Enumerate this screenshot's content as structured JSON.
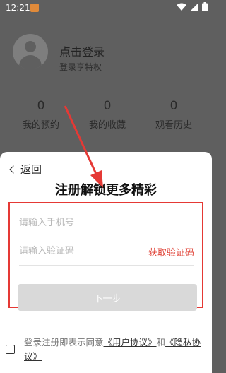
{
  "status_bar": {
    "time": "12:21"
  },
  "profile": {
    "login_title": "点击登录",
    "login_subtitle": "登录享特权",
    "stats": [
      {
        "value": "0",
        "label": "我的预约"
      },
      {
        "value": "0",
        "label": "我的收藏"
      },
      {
        "value": "0",
        "label": "观看历史"
      }
    ]
  },
  "sheet": {
    "back_label": "返回",
    "title": "注册解锁更多精彩",
    "phone_placeholder": "请输入手机号",
    "code_placeholder": "请输入验证码",
    "get_code_label": "获取验证码",
    "next_label": "下一步",
    "agreement": {
      "prefix": "登录注册即表示同意",
      "user_agreement": "《用户协议》",
      "and": "和",
      "privacy_agreement": "《隐私协议》"
    }
  },
  "colors": {
    "accent_red": "#e0453a",
    "annotation_red": "#e53935",
    "overlay": "#5f5f5f"
  }
}
